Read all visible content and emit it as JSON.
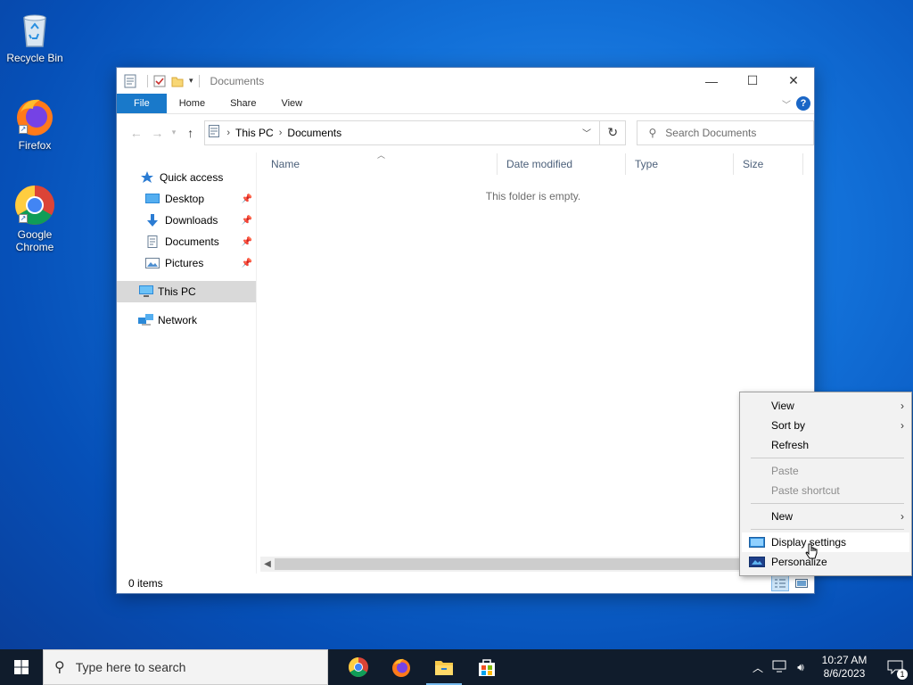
{
  "desktop": {
    "icons": [
      {
        "label": "Recycle Bin"
      },
      {
        "label": "Firefox"
      },
      {
        "label": "Google Chrome"
      }
    ]
  },
  "window": {
    "title": "Documents",
    "controls": {
      "minimize": "—",
      "maximize": "☐",
      "close": "✕"
    },
    "ribbon_tabs": [
      "File",
      "Home",
      "Share",
      "View"
    ],
    "help": "?",
    "breadcrumb": [
      "This PC",
      "Documents"
    ],
    "search_placeholder": "Search Documents",
    "nav": {
      "quick_access": "Quick access",
      "items": [
        "Desktop",
        "Downloads",
        "Documents",
        "Pictures"
      ],
      "this_pc": "This PC",
      "network": "Network"
    },
    "columns": [
      "Name",
      "Date modified",
      "Type",
      "Size"
    ],
    "empty_message": "This folder is empty.",
    "status": "0 items"
  },
  "context_menu": {
    "items": [
      "View",
      "Sort by",
      "Refresh",
      "Paste",
      "Paste shortcut",
      "New",
      "Display settings",
      "Personalize"
    ]
  },
  "taskbar": {
    "search_placeholder": "Type here to search",
    "time": "10:27 AM",
    "date": "8/6/2023",
    "notification_count": "1"
  }
}
